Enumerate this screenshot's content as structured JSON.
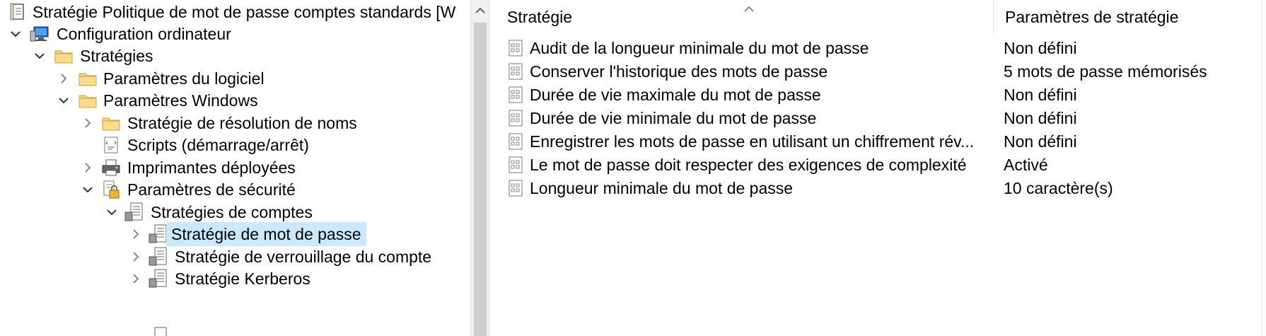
{
  "tree": {
    "items": [
      {
        "label": "Stratégie Politique de mot de passe comptes standards [W",
        "icon": "gpo-document-icon",
        "chevron": ""
      },
      {
        "label": "Configuration ordinateur",
        "icon": "computer-icon",
        "chevron": "expanded"
      },
      {
        "label": "Stratégies",
        "icon": "folder-icon",
        "chevron": "expanded"
      },
      {
        "label": "Paramètres du logiciel",
        "icon": "folder-icon",
        "chevron": "collapsed"
      },
      {
        "label": "Paramètres Windows",
        "icon": "folder-icon",
        "chevron": "expanded"
      },
      {
        "label": "Stratégie de résolution de noms",
        "icon": "folder-icon",
        "chevron": "collapsed"
      },
      {
        "label": "Scripts (démarrage/arrêt)",
        "icon": "scripts-icon",
        "chevron": ""
      },
      {
        "label": "Imprimantes déployées",
        "icon": "printer-icon",
        "chevron": "collapsed"
      },
      {
        "label": "Paramètres de sécurité",
        "icon": "security-settings-icon",
        "chevron": "expanded"
      },
      {
        "label": "Stratégies de comptes",
        "icon": "policy-folder-icon",
        "chevron": "expanded"
      },
      {
        "label": "Stratégie de mot de passe",
        "icon": "policy-folder-icon",
        "chevron": "collapsed",
        "selected": true
      },
      {
        "label": "Stratégie de verrouillage du compte",
        "icon": "policy-folder-icon",
        "chevron": "collapsed"
      },
      {
        "label": "Stratégie Kerberos",
        "icon": "policy-folder-icon",
        "chevron": "collapsed"
      }
    ]
  },
  "list": {
    "columns": [
      "Stratégie",
      "Paramètres de stratégie"
    ],
    "rows": [
      {
        "name": "Audit de la longueur minimale du mot de passe",
        "value": "Non défini"
      },
      {
        "name": "Conserver l'historique des mots de passe",
        "value": "5 mots de passe mémorisés"
      },
      {
        "name": "Durée de vie maximale du mot de passe",
        "value": "Non défini"
      },
      {
        "name": "Durée de vie minimale du mot de passe",
        "value": "Non défini"
      },
      {
        "name": "Enregistrer les mots de passe en utilisant un chiffrement rév...",
        "value": "Non défini"
      },
      {
        "name": "Le mot de passe doit respecter des exigences de complexité",
        "value": "Activé"
      },
      {
        "name": "Longueur minimale du mot de passe",
        "value": "10 caractère(s)"
      }
    ]
  },
  "colors": {
    "selection": "#cce8ff",
    "folder": "#f5d27a",
    "scrollbar_thumb": "#cdcdcd"
  }
}
